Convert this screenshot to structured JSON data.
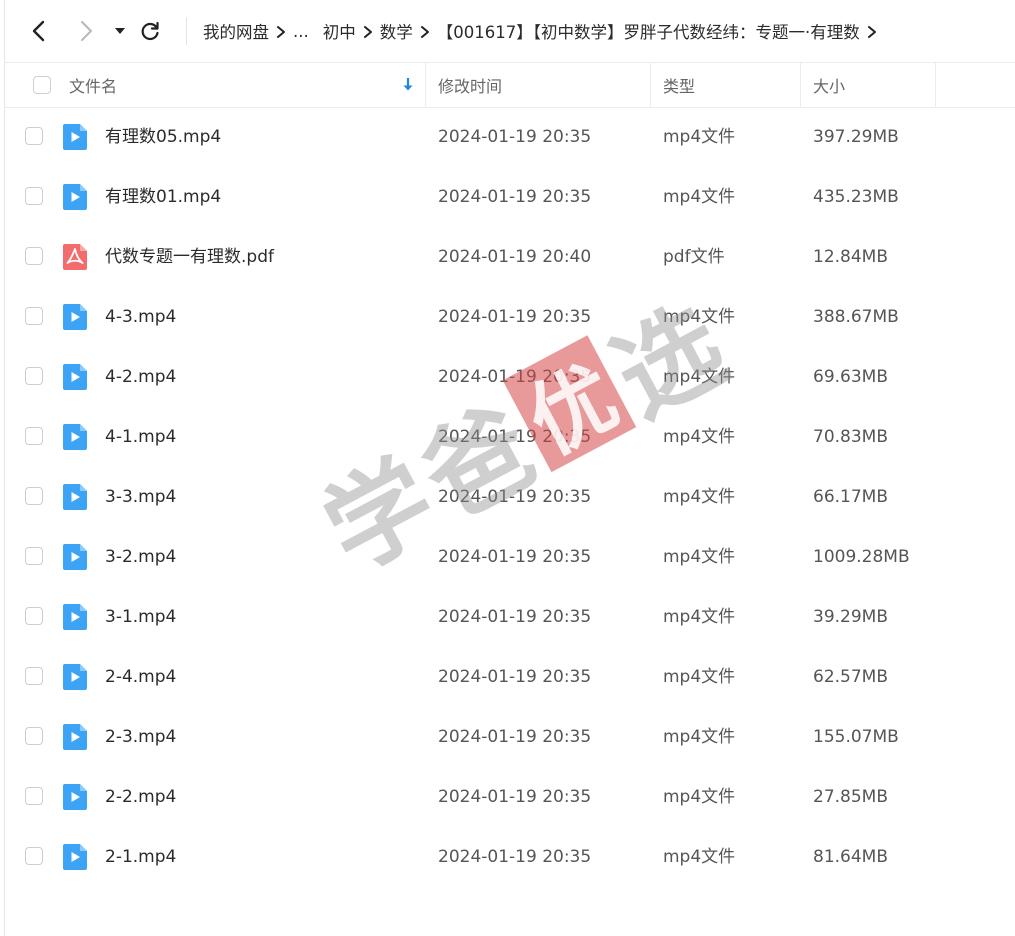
{
  "breadcrumb": {
    "items": [
      "我的网盘",
      "...",
      "初中",
      "数学",
      "【001617】【初中数学】罗胖子代数经纬：专题一·有理数"
    ]
  },
  "table": {
    "headers": {
      "name": "文件名",
      "modified": "修改时间",
      "type": "类型",
      "size": "大小"
    },
    "rows": [
      {
        "name": "有理数05.mp4",
        "modified": "2024-01-19 20:35",
        "type": "mp4文件",
        "size": "397.29MB",
        "icon": "video-file-icon"
      },
      {
        "name": "有理数01.mp4",
        "modified": "2024-01-19 20:35",
        "type": "mp4文件",
        "size": "435.23MB",
        "icon": "video-file-icon"
      },
      {
        "name": "代数专题一有理数.pdf",
        "modified": "2024-01-19 20:40",
        "type": "pdf文件",
        "size": "12.84MB",
        "icon": "pdf-file-icon"
      },
      {
        "name": "4-3.mp4",
        "modified": "2024-01-19 20:35",
        "type": "mp4文件",
        "size": "388.67MB",
        "icon": "video-file-icon"
      },
      {
        "name": "4-2.mp4",
        "modified": "2024-01-19 20:35",
        "type": "mp4文件",
        "size": "69.63MB",
        "icon": "video-file-icon"
      },
      {
        "name": "4-1.mp4",
        "modified": "2024-01-19 20:35",
        "type": "mp4文件",
        "size": "70.83MB",
        "icon": "video-file-icon"
      },
      {
        "name": "3-3.mp4",
        "modified": "2024-01-19 20:35",
        "type": "mp4文件",
        "size": "66.17MB",
        "icon": "video-file-icon"
      },
      {
        "name": "3-2.mp4",
        "modified": "2024-01-19 20:35",
        "type": "mp4文件",
        "size": "1009.28MB",
        "icon": "video-file-icon"
      },
      {
        "name": "3-1.mp4",
        "modified": "2024-01-19 20:35",
        "type": "mp4文件",
        "size": "39.29MB",
        "icon": "video-file-icon"
      },
      {
        "name": "2-4.mp4",
        "modified": "2024-01-19 20:35",
        "type": "mp4文件",
        "size": "62.57MB",
        "icon": "video-file-icon"
      },
      {
        "name": "2-3.mp4",
        "modified": "2024-01-19 20:35",
        "type": "mp4文件",
        "size": "155.07MB",
        "icon": "video-file-icon"
      },
      {
        "name": "2-2.mp4",
        "modified": "2024-01-19 20:35",
        "type": "mp4文件",
        "size": "27.85MB",
        "icon": "video-file-icon"
      },
      {
        "name": "2-1.mp4",
        "modified": "2024-01-19 20:35",
        "type": "mp4文件",
        "size": "81.64MB",
        "icon": "video-file-icon"
      }
    ]
  },
  "watermark": {
    "chars": [
      "学",
      "爸",
      "优",
      "选"
    ]
  },
  "colors": {
    "video_icon": "#3da3f5",
    "pdf_icon": "#f26c6c",
    "sort_arrow": "#1e88e5",
    "watermark_seal": "#d64646"
  }
}
